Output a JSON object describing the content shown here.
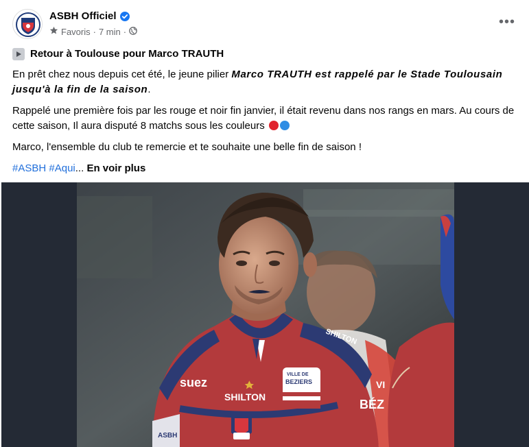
{
  "post": {
    "page_name": "ASBH Officiel",
    "audience_label": "Favoris",
    "separator": "·",
    "time": "7 min",
    "separator2": "·",
    "more_label": "•••",
    "title": "Retour à Toulouse pour Marco TRAUTH",
    "para1_prefix": "En prêt chez nous depuis cet été, le jeune pilier ",
    "para1_emph": "Marco TRAUTH est rappelé par le Stade Toulousain jusqu'à la fin de la saison",
    "para1_suffix": ".",
    "para2": "Rappelé une première fois par les rouge et noir fin janvier, il était revenu dans nos rangs en mars. Au cours de cette saison, Il aura disputé 8 matchs sous les couleurs",
    "para3": "Marco, l'ensemble du club te remercie et te souhaite une belle fin de saison !",
    "hashtag1": "#ASBH",
    "hashtag2": "#Aqui",
    "ellipsis": "...",
    "see_more": "En voir plus"
  },
  "photo": {
    "jersey_sponsor": "suez",
    "jersey_brand": "SHILTON",
    "jersey_brand2": "SHILTON",
    "badge_top": "VILLE DE",
    "badge_city": "BEZIERS",
    "crest_text": "ASBH",
    "side_text": "BÉZ",
    "side_text_top": "VI",
    "sleeve_text": "ASBH"
  },
  "colors": {
    "accent_blue": "#216fdb",
    "meta_gray": "#65676b",
    "jersey_red": "#b33a3c",
    "jersey_blue": "#2c3a73",
    "dot_red": "#e0242e",
    "dot_blue": "#2f8de4"
  },
  "icons": {
    "verified": "verified-badge-icon",
    "audience": "star-icon",
    "globe": "globe-icon",
    "play": "play-icon",
    "more": "more-options-icon"
  }
}
